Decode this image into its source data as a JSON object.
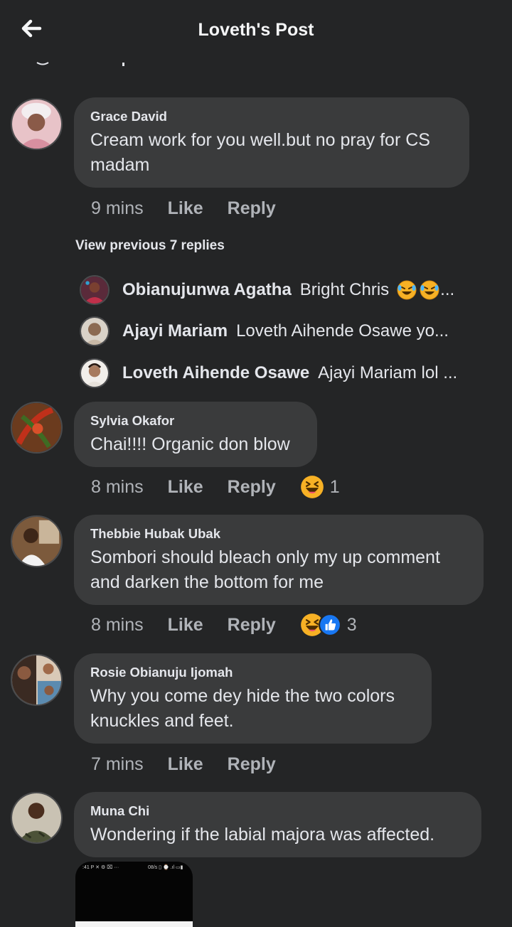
{
  "header": {
    "title": "Loveth's Post"
  },
  "comments": [
    {
      "author": "Grace David",
      "text_lines": [
        "Cream work for you well.but no pray for CS",
        "madam"
      ],
      "time": "9 mins",
      "like": "Like",
      "reply": "Reply"
    },
    {
      "author": "Sylvia Okafor",
      "text_lines": [
        "Chai!!!! Organic don blow"
      ],
      "time": "8 mins",
      "like": "Like",
      "reply": "Reply",
      "reaction_count": "1"
    },
    {
      "author": "Thebbie Hubak Ubak",
      "text_lines": [
        "Sombori should bleach only my up comment",
        "and darken the bottom for me"
      ],
      "time": "8 mins",
      "like": "Like",
      "reply": "Reply",
      "reaction_count": "3"
    },
    {
      "author": "Rosie Obianuju Ijomah",
      "text_lines": [
        "Why you come dey hide the two colors",
        "knuckles and feet."
      ],
      "time": "7 mins",
      "like": "Like",
      "reply": "Reply"
    },
    {
      "author": "Muna Chi",
      "text_lines": [
        "Wondering if the labial majora was affected."
      ]
    }
  ],
  "thread": {
    "view_previous": "View previous 7 replies",
    "replies": [
      {
        "name": "Obianujunwa Agatha",
        "text": "Bright Chris",
        "suffix": "..."
      },
      {
        "name": "Ajayi Mariam",
        "text": "Loveth Aihende Osawe yo..."
      },
      {
        "name": "Loveth Aihende Osawe",
        "text": "Ajayi Mariam lol ..."
      }
    ]
  },
  "attachment": {
    "status_left": ":41 P ✕ ⚙ ⌧ ···",
    "status_right": "08/s ▯ ⌚ .ıl ▭▮"
  },
  "icons": {
    "back": "arrow-left-icon",
    "haha": "haha-reaction-icon",
    "like": "like-reaction-icon",
    "rofl": "rofl-emoji-icon"
  },
  "colors": {
    "background": "#242526",
    "bubble": "#3a3b3c",
    "text": "#e4e6eb",
    "secondary": "#b0b3b8",
    "like_blue": "#1877f2",
    "haha_yellow": "#f7b125"
  }
}
